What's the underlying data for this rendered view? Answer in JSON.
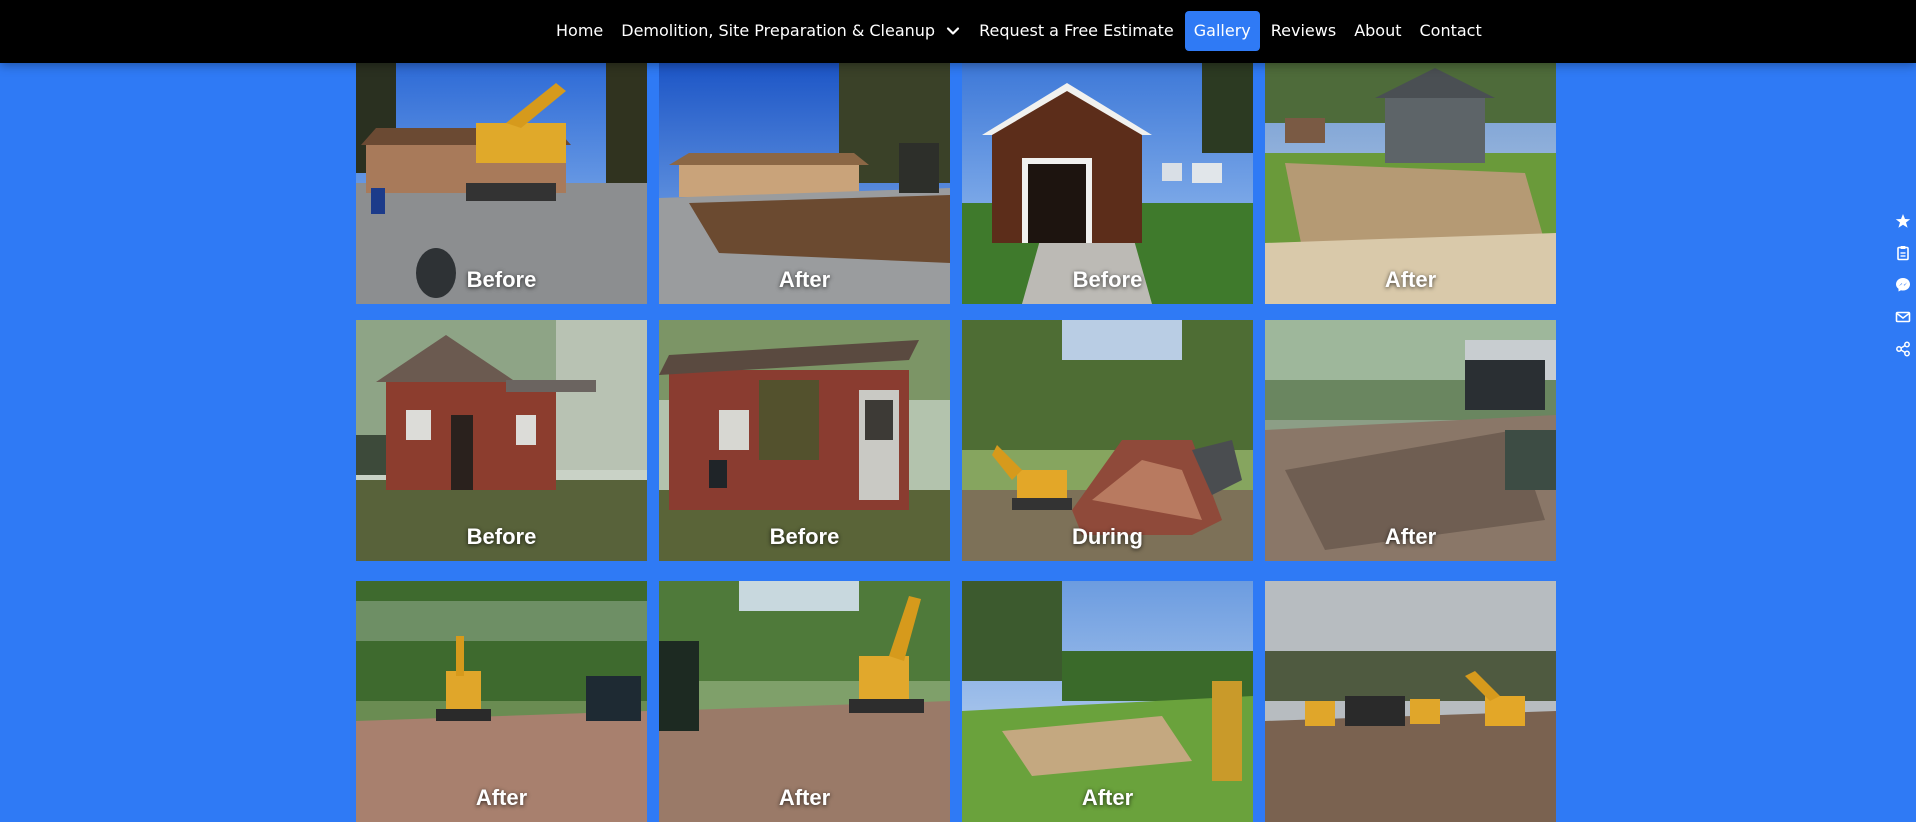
{
  "nav": {
    "items": [
      {
        "label": "Home"
      },
      {
        "label": "Demolition, Site Preparation & Cleanup",
        "has_dropdown": true
      },
      {
        "label": "Request a Free Estimate"
      },
      {
        "label": "Gallery",
        "active": true
      },
      {
        "label": "Reviews"
      },
      {
        "label": "About"
      },
      {
        "label": "Contact"
      }
    ]
  },
  "gallery": {
    "tiles": [
      {
        "caption": "Before",
        "scene": "excavator at house"
      },
      {
        "caption": "After",
        "scene": "cleared lot by house"
      },
      {
        "caption": "Before",
        "scene": "brown garage"
      },
      {
        "caption": "After",
        "scene": "cleared dirt yard"
      },
      {
        "caption": "Before",
        "scene": "red shack"
      },
      {
        "caption": "Before",
        "scene": "red shack side"
      },
      {
        "caption": "During",
        "scene": "excavator demolishing"
      },
      {
        "caption": "After",
        "scene": "cleared lot with truck"
      },
      {
        "caption": "After",
        "scene": "excavator in woods"
      },
      {
        "caption": "After",
        "scene": "excavator with dump truck"
      },
      {
        "caption": "After",
        "scene": "graded lawn with excavator"
      },
      {
        "caption": "",
        "scene": "equipment on cleared land"
      }
    ]
  },
  "sidebar": {
    "icons": [
      "star-icon",
      "clipboard-icon",
      "messenger-icon",
      "mail-icon",
      "share-icon"
    ]
  },
  "colors": {
    "nav_bg": "#000000",
    "accent": "#2f7af5",
    "page_bg": "#2f7af5"
  }
}
